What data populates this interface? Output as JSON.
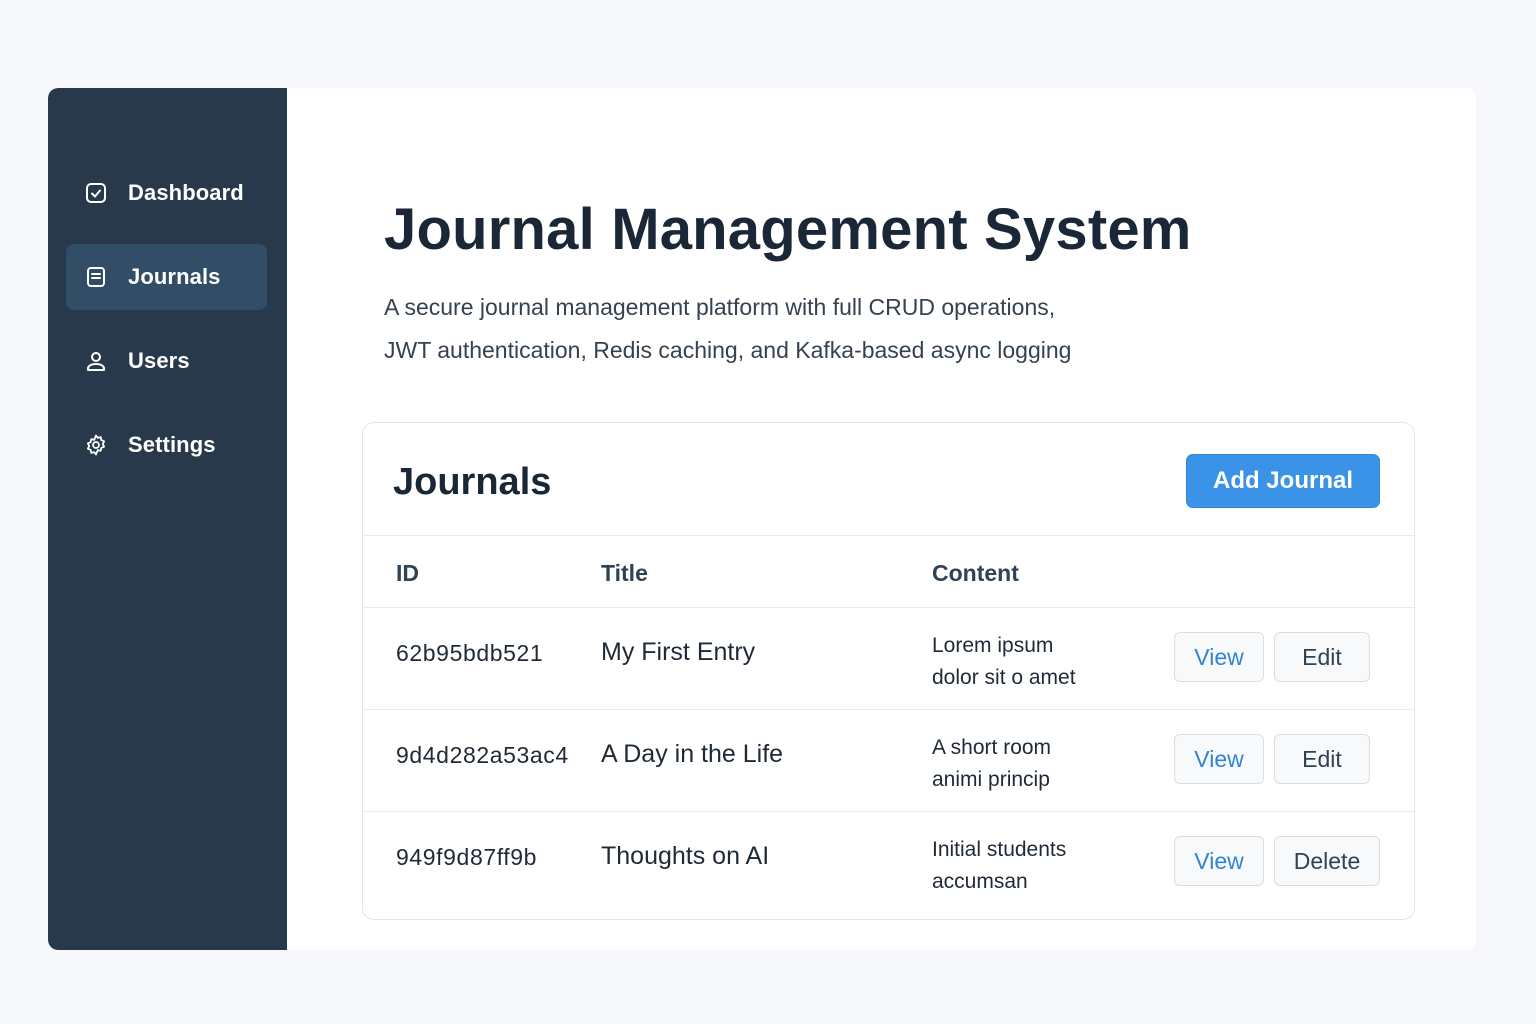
{
  "sidebar": {
    "items": [
      {
        "label": "Dashboard",
        "icon": "dashboard-check-icon",
        "active": false
      },
      {
        "label": "Journals",
        "icon": "document-icon",
        "active": true
      },
      {
        "label": "Users",
        "icon": "user-icon",
        "active": false
      },
      {
        "label": "Settings",
        "icon": "gear-icon",
        "active": false
      }
    ]
  },
  "header": {
    "title": "Journal Management System",
    "subtitle_line1": "A secure journal management platform with full CRUD operations,",
    "subtitle_line2": "JWT authentication, Redis caching, and Kafka-based async logging"
  },
  "card": {
    "title": "Journals",
    "add_button": "Add Journal",
    "columns": [
      "ID",
      "Title",
      "Content"
    ],
    "rows": [
      {
        "id": "62b95bdb521",
        "title": "My First Entry",
        "content_line1": "Lorem ipsum",
        "content_line2": "dolor sit o amet",
        "action1": "View",
        "action2": "Edit"
      },
      {
        "id": "9d4d282a53ac4",
        "title": "A Day in the Life",
        "content_line1": "A short room",
        "content_line2": "animi princip",
        "action1": "View",
        "action2": "Edit"
      },
      {
        "id": "949f9d87ff9b",
        "title": "Thoughts on AI",
        "content_line1": "Initial students",
        "content_line2": "accumsan",
        "action1": "View",
        "action2": "Delete"
      }
    ]
  },
  "colors": {
    "sidebar_bg": "#27394b",
    "sidebar_active_bg": "#324d66",
    "accent": "#3a93e6",
    "view_text": "#2f84d6",
    "page_bg": "#f6f8fb"
  }
}
